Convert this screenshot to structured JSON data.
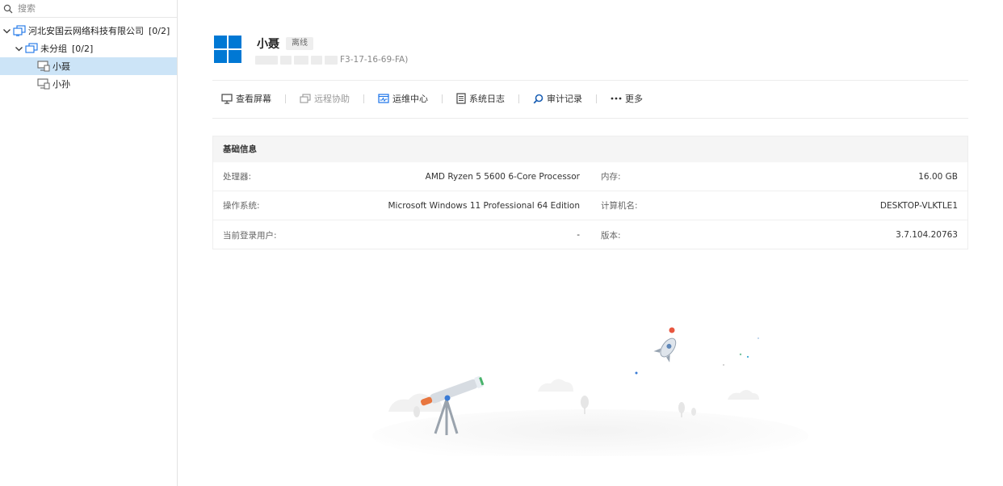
{
  "sidebar": {
    "search_placeholder": "搜索",
    "tree": [
      {
        "label": "河北安国云网络科技有限公司",
        "count": "[0/2]",
        "level": 0
      },
      {
        "label": "未分组",
        "count": "[0/2]",
        "level": 1
      },
      {
        "label": "小聂",
        "level": 2,
        "selected": true
      },
      {
        "label": "小孙",
        "level": 2
      }
    ]
  },
  "device": {
    "name": "小聂",
    "status": "离线",
    "mac_suffix": "F3-17-16-69-FA)"
  },
  "toolbar": {
    "view_screen": "查看屏幕",
    "remote_assist": "远程协助",
    "ops_center": "运维中心",
    "system_log": "系统日志",
    "audit_log": "审计记录",
    "more": "更多"
  },
  "basic_info": {
    "title": "基础信息",
    "rows": [
      {
        "left_label": "处理器:",
        "left_value": "AMD Ryzen 5 5600 6-Core Processor",
        "right_label": "内存:",
        "right_value": "16.00 GB"
      },
      {
        "left_label": "操作系统:",
        "left_value": "Microsoft Windows 11 Professional 64 Edition",
        "right_label": "计算机名:",
        "right_value": "DESKTOP-VLKTLE1"
      },
      {
        "left_label": "当前登录用户:",
        "left_value": "-",
        "right_label": "版本:",
        "right_value": "3.7.104.20763"
      }
    ]
  },
  "colors": {
    "accent": "#1a73e8",
    "windows_blue": "#0078d4",
    "selected_row": "#cce4f7"
  }
}
